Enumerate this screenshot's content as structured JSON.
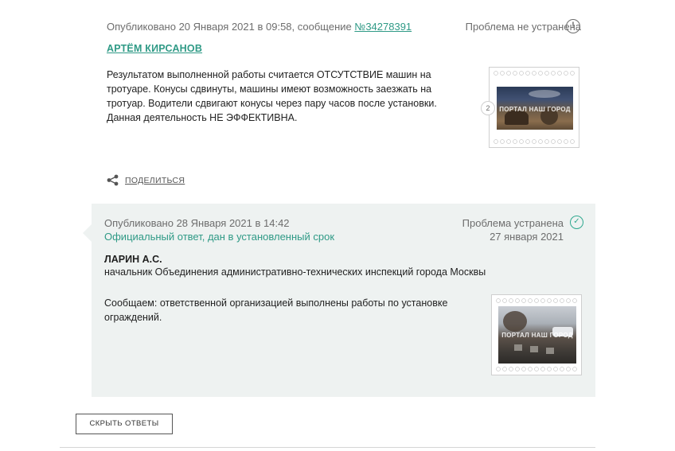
{
  "message": {
    "published_prefix": "Опубликовано 20 Января 2021 в 09:58, сообщение ",
    "message_number": "№34278391",
    "status": "Проблема не устранена",
    "author": "АРТЁМ КИРСАНОВ",
    "text": "Результатом выполненной работы считается ОТСУТСТВИЕ машин на тротуаре. Конусы сдвинуты, машины имеют возможность заезжать на тротуар. Водители сдвигают конусы через пару часов после установки. Данная деятельность НЕ ЭФФЕКТИВНА.",
    "photo_count": "2",
    "photo_watermark": "ПОРТАЛ НАШ ГОРОД",
    "share_label": "ПОДЕЛИТЬСЯ"
  },
  "reply": {
    "published": "Опубликовано 28 Января 2021 в 14:42",
    "official": "Официальный ответ, дан в установленный срок",
    "status": "Проблема устранена",
    "status_date": "27 января 2021",
    "responder": "ЛАРИН А.С.",
    "position": "начальник Объединения административно-технических инспекций города Москвы",
    "text": "Сообщаем: ответственной организацией выполнены работы по установке ограждений.",
    "photo_watermark": "ПОРТАЛ НАШ ГОРОД"
  },
  "hide_replies_label": "СКРЫТЬ ОТВЕТЫ",
  "colors": {
    "accent": "#2f9a86",
    "reply_background": "#eef2f1",
    "muted_text": "#6d6d6d"
  },
  "icons": {
    "unresolved": "exclamation-circle-icon",
    "resolved": "check-circle-icon",
    "share": "share-icon"
  }
}
